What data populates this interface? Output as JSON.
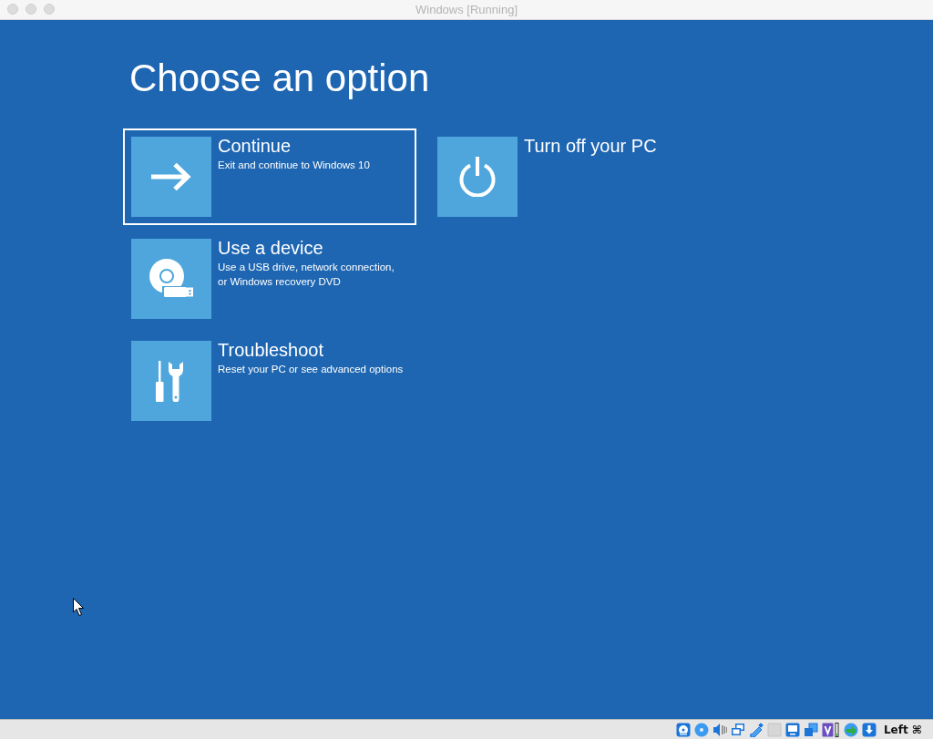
{
  "window": {
    "title": "Windows [Running]"
  },
  "screen": {
    "heading": "Choose an option",
    "options": [
      {
        "title": "Continue",
        "description": "Exit and continue to Windows 10",
        "selected": true
      },
      {
        "title": "Use a device",
        "description": "Use a USB drive, network connection,\nor Windows recovery DVD",
        "selected": false
      },
      {
        "title": "Troubleshoot",
        "description": "Reset your PC or see advanced options",
        "selected": false
      },
      {
        "title": "Turn off your PC",
        "selected": false
      }
    ]
  },
  "status_bar": {
    "host_key": "Left ⌘"
  }
}
